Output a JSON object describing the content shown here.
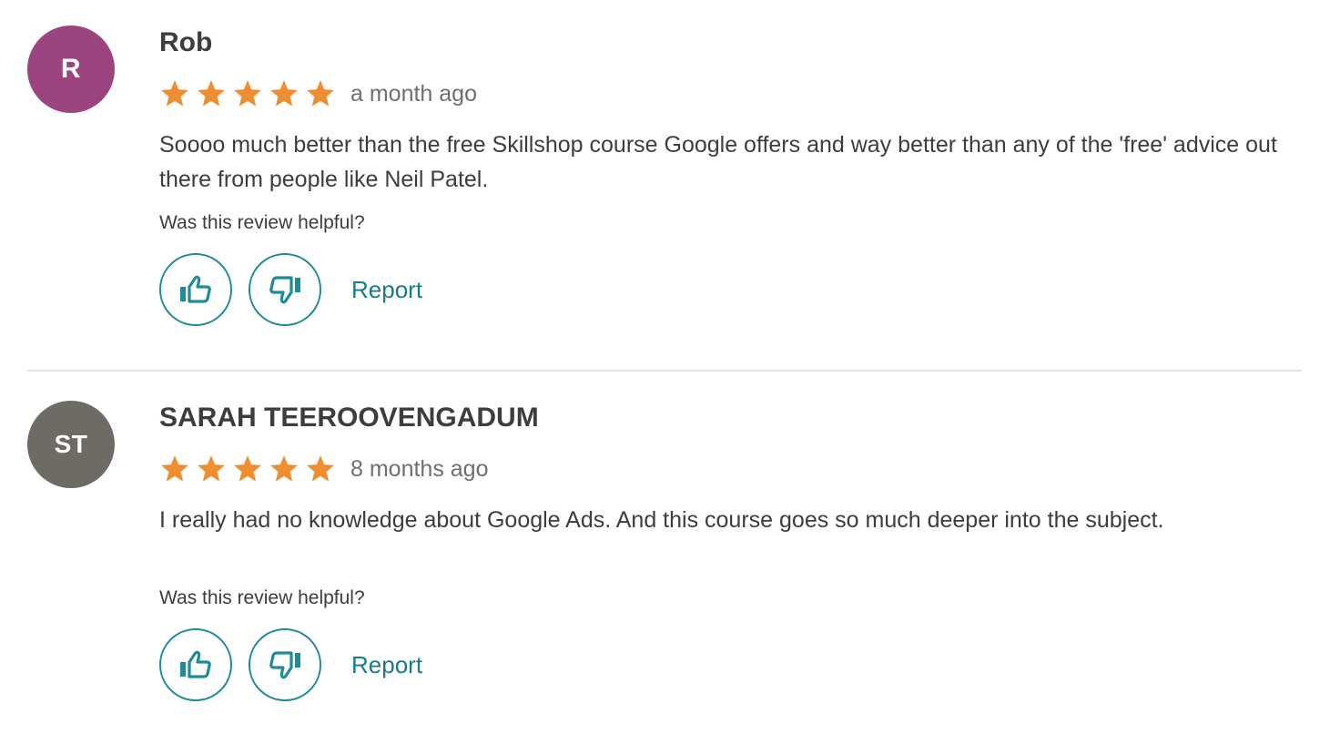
{
  "colors": {
    "star": "#ef8e31",
    "accent": "#1f8a98",
    "divider": "#e3e1dc"
  },
  "helpful_prompt": "Was this review helpful?",
  "reviews": [
    {
      "avatar_initials": "R",
      "avatar_color": "#9b447f",
      "name": "Rob",
      "rating": 5,
      "rating_max": 5,
      "time": "a month ago",
      "text": "Soooo much better than the free Skillshop course Google offers and way better than any of the 'free' advice out there from people like Neil Patel.",
      "helpful_label": "Was this review helpful?",
      "like_icon": "thumbs-up-icon",
      "dislike_icon": "thumbs-down-icon",
      "report_label": "Report"
    },
    {
      "avatar_initials": "ST",
      "avatar_color": "#6e6b65",
      "name": "SARAH TEEROOVENGADUM",
      "rating": 5,
      "rating_max": 5,
      "time": "8 months ago",
      "text": "I really had no knowledge about Google Ads. And this course goes so much deeper into the subject.",
      "helpful_label": "Was this review helpful?",
      "like_icon": "thumbs-up-icon",
      "dislike_icon": "thumbs-down-icon",
      "report_label": "Report"
    }
  ]
}
